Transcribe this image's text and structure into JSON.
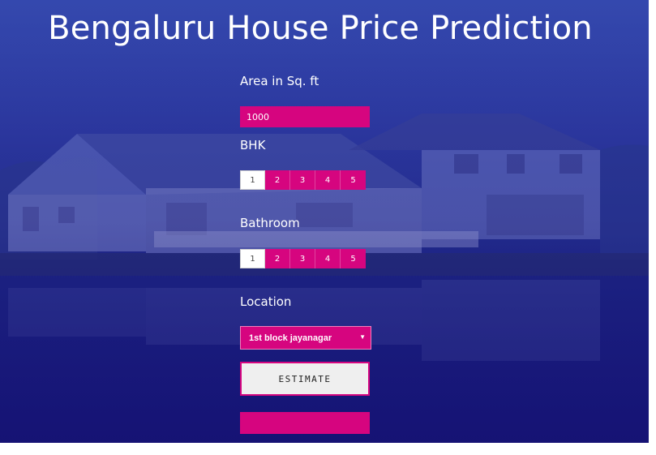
{
  "page": {
    "title": "Bengaluru House Price Prediction"
  },
  "form": {
    "area": {
      "label": "Area in Sq. ft",
      "value": "1000"
    },
    "bhk": {
      "label": "BHK",
      "options": [
        "1",
        "2",
        "3",
        "4",
        "5"
      ],
      "selected": "1"
    },
    "bathroom": {
      "label": "Bathroom",
      "options": [
        "1",
        "2",
        "3",
        "4",
        "5"
      ],
      "selected": "1"
    },
    "location": {
      "label": "Location",
      "selected": "1st block jayanagar",
      "caret": "▼"
    },
    "estimate_label": "ESTIMATE",
    "result_text": ""
  },
  "colors": {
    "accent": "#d6057f",
    "background": "#1f2a86"
  }
}
